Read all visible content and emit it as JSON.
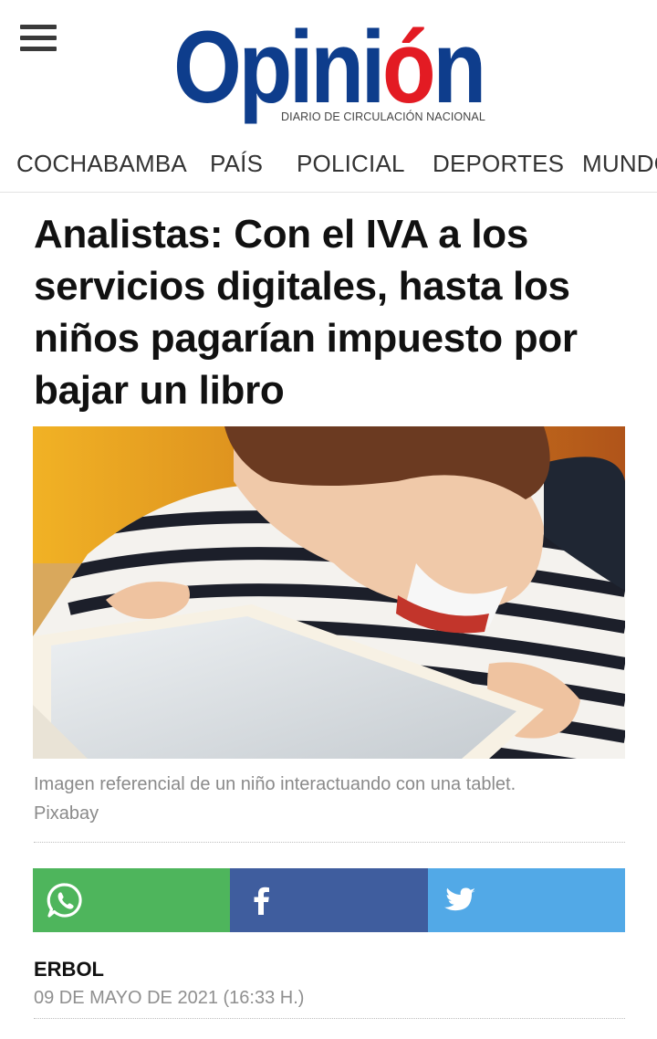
{
  "header": {
    "logo": {
      "word_main": "Opini",
      "word_accent": "ó",
      "word_end": "n",
      "tagline": "DIARIO DE CIRCULACIÓN NACIONAL"
    },
    "menu_icon": "hamburger-menu-icon"
  },
  "nav": {
    "items": [
      {
        "label": "COCHABAMBA"
      },
      {
        "label": "PAÍS"
      },
      {
        "label": "POLICIAL"
      },
      {
        "label": "DEPORTES"
      },
      {
        "label": "MUNDO"
      }
    ]
  },
  "article": {
    "headline": "Analistas: Con el IVA a los servicios digitales, hasta los niños pagarían impuesto por bajar un libro",
    "image_caption": "Imagen referencial de un niño interactuando con una tablet.",
    "image_credit": "Pixabay",
    "author": "ERBOL",
    "date": "09 DE MAYO DE 2021 (16:33 H.)"
  },
  "share": {
    "buttons": [
      {
        "icon": "whatsapp-icon",
        "color": "#4eb55c"
      },
      {
        "icon": "facebook-icon",
        "color": "#3f5d9e"
      },
      {
        "icon": "twitter-icon",
        "color": "#52a9e7"
      }
    ]
  },
  "colors": {
    "brand_blue": "#0e3d8c",
    "brand_red": "#e31b23"
  }
}
